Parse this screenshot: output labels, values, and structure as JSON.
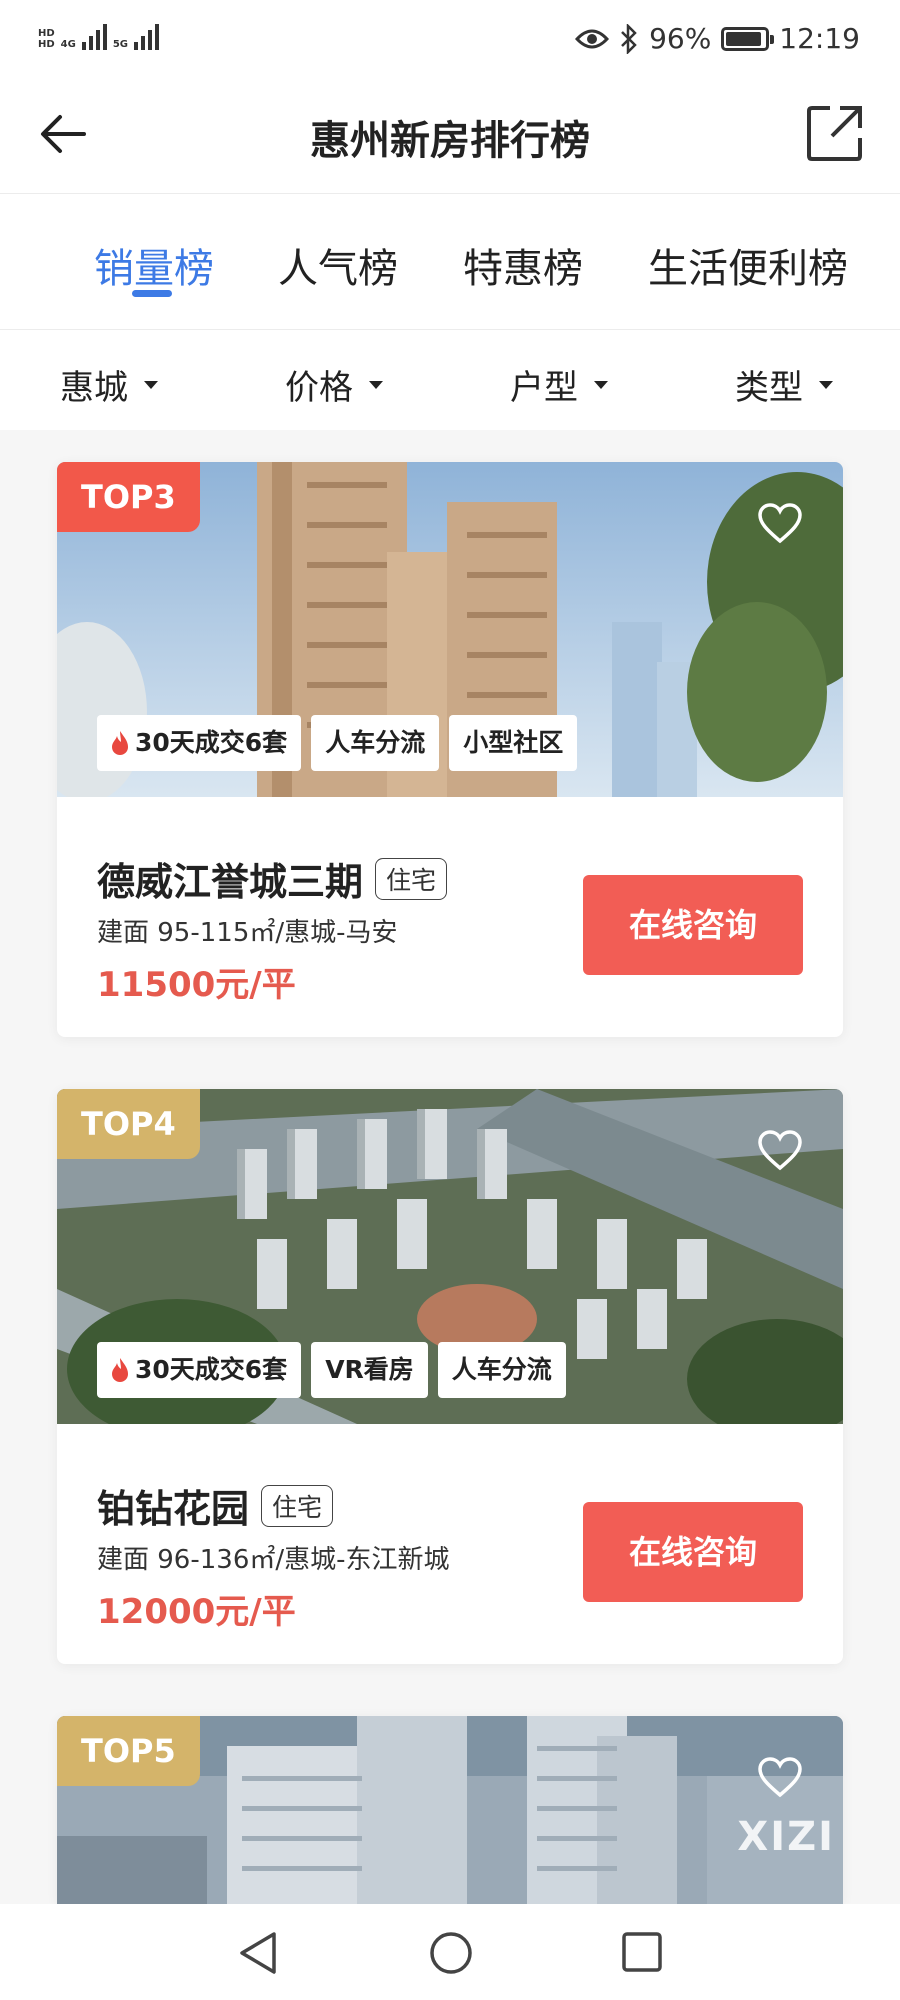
{
  "status_bar": {
    "network1": "HD",
    "network_4g": "4G",
    "network_5g": "5G",
    "battery": "96%",
    "time": "12:19"
  },
  "header": {
    "title": "惠州新房排行榜"
  },
  "tabs": [
    {
      "label": "销量榜",
      "active": true
    },
    {
      "label": "人气榜",
      "active": false
    },
    {
      "label": "特惠榜",
      "active": false
    },
    {
      "label": "生活便利榜",
      "active": false
    }
  ],
  "filters": [
    {
      "label": "惠城"
    },
    {
      "label": "价格"
    },
    {
      "label": "户型"
    },
    {
      "label": "类型"
    }
  ],
  "listings": [
    {
      "rank": "TOP3",
      "rank_color": "#f2584a",
      "tags": [
        "30天成交6套",
        "人车分流",
        "小型社区"
      ],
      "name": "德威江誉城三期",
      "type": "住宅",
      "info": "建面 95-115㎡/惠城-马安",
      "price": "11500元/平",
      "button": "在线咨询"
    },
    {
      "rank": "TOP4",
      "rank_color": "#d4b46a",
      "tags": [
        "30天成交6套",
        "VR看房",
        "人车分流"
      ],
      "name": "铂钻花园",
      "type": "住宅",
      "info": "建面 96-136㎡/惠城-东江新城",
      "price": "12000元/平",
      "button": "在线咨询"
    },
    {
      "rank": "TOP5",
      "rank_color": "#d4b46a",
      "watermark": "XIZI"
    }
  ],
  "colors": {
    "accent": "#3d7ae5",
    "price": "#e55a4e",
    "button": "#f25d55"
  }
}
